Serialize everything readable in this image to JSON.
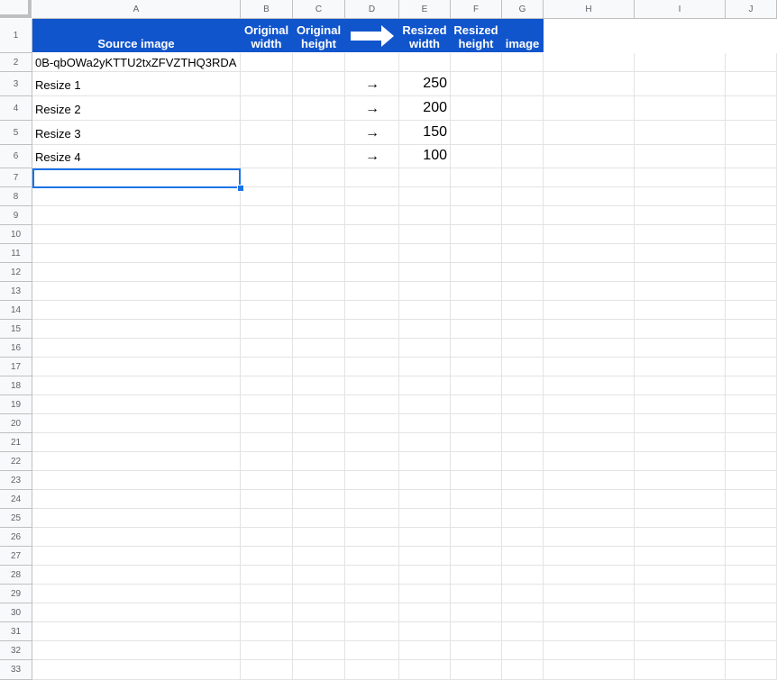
{
  "columns": [
    "A",
    "B",
    "C",
    "D",
    "E",
    "F",
    "G",
    "H",
    "I",
    "J"
  ],
  "rows": [
    "1",
    "2",
    "3",
    "4",
    "5",
    "6",
    "7",
    "8",
    "9",
    "10",
    "11",
    "12",
    "13",
    "14",
    "15",
    "16",
    "17",
    "18",
    "19",
    "20",
    "21",
    "22",
    "23",
    "24",
    "25",
    "26",
    "27",
    "28",
    "29",
    "30",
    "31",
    "32",
    "33"
  ],
  "header_row": {
    "a": "Source image",
    "b": "Original width",
    "c": "Original height",
    "d_icon": "right-arrow-shape",
    "e": "Resized width",
    "f": "Resized height",
    "g": "image"
  },
  "row2": {
    "a": "0B-qbOWa2yKTTU2txZFVZTHQ3RDA"
  },
  "data_rows": [
    {
      "a": "Resize 1",
      "d": "→",
      "e": "250"
    },
    {
      "a": "Resize 2",
      "d": "→",
      "e": "200"
    },
    {
      "a": "Resize 3",
      "d": "→",
      "e": "150"
    },
    {
      "a": "Resize 4",
      "d": "→",
      "e": "100"
    }
  ],
  "selected_cell": "A7",
  "colors": {
    "header_bg": "#1155cc",
    "selection": "#1a73e8"
  }
}
